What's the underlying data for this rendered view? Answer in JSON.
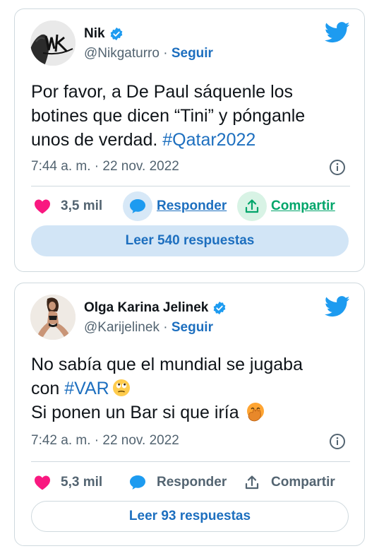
{
  "tweets": [
    {
      "author": {
        "name": "Nik",
        "handle": "@Nikgaturro",
        "follow_label": "Seguir",
        "verified": true
      },
      "text_parts": {
        "line1": "Por favor, a De Paul sáquenle los",
        "line2": "botines que dicen “Tini” y pónganle",
        "line3": "unos de verdad. ",
        "hashtag": "#Qatar2022"
      },
      "time": "7:44 a. m.",
      "separator": " · ",
      "date": "22 nov. 2022",
      "likes": "3,5 mil",
      "reply_label": "Responder",
      "share_label": "Compartir",
      "read_replies": "Leer 540 respuestas"
    },
    {
      "author": {
        "name": "Olga Karina Jelinek",
        "handle": "@Karijelinek",
        "follow_label": "Seguir",
        "verified": true
      },
      "text_parts": {
        "line1": "No sabía que el mundial se jugaba",
        "line2_pre": "con ",
        "hashtag": "#VAR",
        "line3": "Si ponen un Bar si que iría"
      },
      "time": "7:42 a. m.",
      "separator": " · ",
      "date": "22 nov. 2022",
      "likes": "5,3 mil",
      "reply_label": "Responder",
      "share_label": "Compartir",
      "read_replies": "Leer 93 respuestas"
    }
  ],
  "colors": {
    "link": "#1d6fbf",
    "like": "#f91880",
    "share": "#00a56a",
    "twitter": "#1d9bf0",
    "muted": "#536471"
  },
  "icons": [
    "verified-badge-icon",
    "twitter-bird-icon",
    "info-icon",
    "heart-icon",
    "reply-bubble-icon",
    "share-icon",
    "rolling-eyes-emoji-icon",
    "face-hand-over-mouth-emoji-icon"
  ]
}
